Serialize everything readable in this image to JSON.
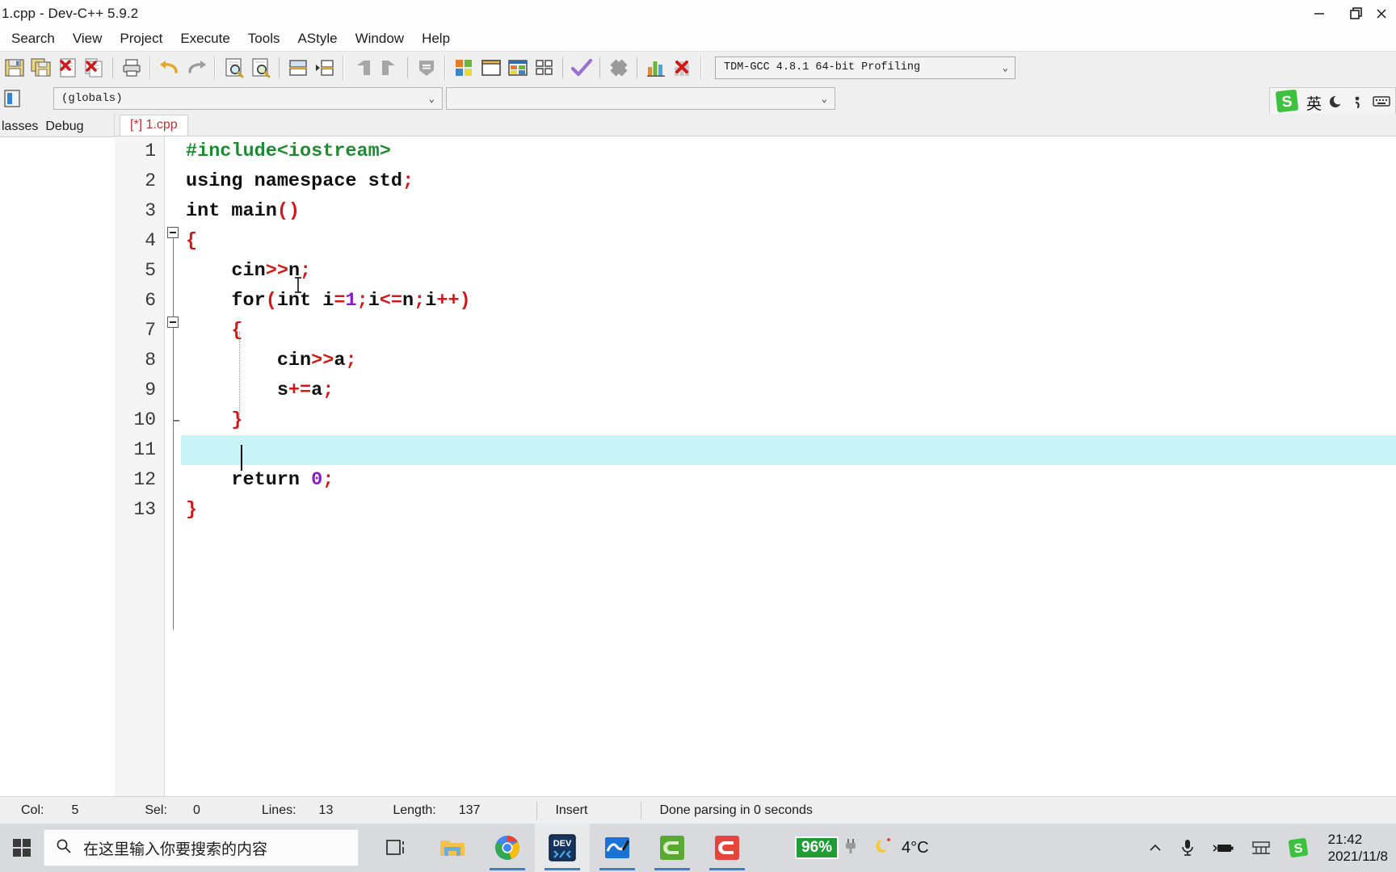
{
  "window": {
    "title": "1.cpp - Dev-C++ 5.9.2",
    "minimize_label": "minimize",
    "restore_label": "restore",
    "close_label": "close"
  },
  "menu": {
    "items": [
      {
        "label": "Search"
      },
      {
        "label": "View"
      },
      {
        "label": "Project"
      },
      {
        "label": "Execute"
      },
      {
        "label": "Tools"
      },
      {
        "label": "AStyle"
      },
      {
        "label": "Window"
      },
      {
        "label": "Help"
      }
    ]
  },
  "toolbar": {
    "icons": [
      {
        "name": "save-icon"
      },
      {
        "name": "save-all-icon"
      },
      {
        "name": "close-file-icon"
      },
      {
        "name": "close-all-icon"
      },
      {
        "name": "print-icon"
      },
      {
        "name": "undo-icon"
      },
      {
        "name": "redo-icon"
      },
      {
        "name": "find-icon"
      },
      {
        "name": "replace-icon"
      },
      {
        "name": "goto-line-icon"
      },
      {
        "name": "goto-function-icon"
      },
      {
        "name": "back-icon"
      },
      {
        "name": "forward-icon"
      },
      {
        "name": "toggle-breakpoint-icon"
      },
      {
        "name": "new-project-icon"
      },
      {
        "name": "new-file-icon"
      },
      {
        "name": "project-options-icon"
      },
      {
        "name": "window-list-icon"
      },
      {
        "name": "compile-run-icon"
      },
      {
        "name": "stop-icon"
      },
      {
        "name": "profile-icon"
      },
      {
        "name": "delete-profile-icon"
      }
    ],
    "compiler_set": "TDM-GCC 4.8.1 64-bit Profiling",
    "compiler_arrow": "⌄"
  },
  "navbar": {
    "class_browser_icon": "class-browser-icon",
    "scope_value": "(globals)",
    "member_value": "",
    "arrow": "⌄"
  },
  "left_panel": {
    "tabs": [
      {
        "label": "lasses"
      },
      {
        "label": "Debug"
      }
    ]
  },
  "editor": {
    "tab_label": "[*] 1.cpp",
    "lines": [
      {
        "num": "1",
        "tokens": [
          {
            "t": "#include<iostream>",
            "c": "t-pre"
          }
        ]
      },
      {
        "num": "2",
        "tokens": [
          {
            "t": "using namespace std",
            "c": "t-kw"
          },
          {
            "t": ";",
            "c": "t-sym"
          }
        ]
      },
      {
        "num": "3",
        "tokens": [
          {
            "t": "int main",
            "c": "t-kw"
          },
          {
            "t": "()",
            "c": "t-sym"
          }
        ]
      },
      {
        "num": "4",
        "tokens": [
          {
            "t": "{",
            "c": "t-sym"
          }
        ]
      },
      {
        "num": "5",
        "tokens": [
          {
            "t": "    cin",
            "c": "t-id"
          },
          {
            "t": ">>",
            "c": "t-sym"
          },
          {
            "t": "n",
            "c": "t-id"
          },
          {
            "t": ";",
            "c": "t-sym"
          }
        ]
      },
      {
        "num": "6",
        "tokens": [
          {
            "t": "    for",
            "c": "t-kw"
          },
          {
            "t": "(",
            "c": "t-sym"
          },
          {
            "t": "int",
            "c": "t-kw"
          },
          {
            "t": " i",
            "c": "t-id"
          },
          {
            "t": "=",
            "c": "t-sym"
          },
          {
            "t": "1",
            "c": "t-num"
          },
          {
            "t": ";",
            "c": "t-sym"
          },
          {
            "t": "i",
            "c": "t-id"
          },
          {
            "t": "<=",
            "c": "t-sym"
          },
          {
            "t": "n",
            "c": "t-id"
          },
          {
            "t": ";",
            "c": "t-sym"
          },
          {
            "t": "i",
            "c": "t-id"
          },
          {
            "t": "++)",
            "c": "t-sym"
          }
        ]
      },
      {
        "num": "7",
        "tokens": [
          {
            "t": "    {",
            "c": "t-sym"
          }
        ]
      },
      {
        "num": "8",
        "tokens": [
          {
            "t": "        cin",
            "c": "t-id"
          },
          {
            "t": ">>",
            "c": "t-sym"
          },
          {
            "t": "a",
            "c": "t-id"
          },
          {
            "t": ";",
            "c": "t-sym"
          }
        ]
      },
      {
        "num": "9",
        "tokens": [
          {
            "t": "        s",
            "c": "t-id"
          },
          {
            "t": "+=",
            "c": "t-sym"
          },
          {
            "t": "a",
            "c": "t-id"
          },
          {
            "t": ";",
            "c": "t-sym"
          }
        ]
      },
      {
        "num": "10",
        "tokens": [
          {
            "t": "    }",
            "c": "t-sym"
          }
        ]
      },
      {
        "num": "11",
        "tokens": [
          {
            "t": "    ",
            "c": "t-id"
          }
        ],
        "active": true
      },
      {
        "num": "12",
        "tokens": [
          {
            "t": "    return",
            "c": "t-kw"
          },
          {
            "t": " ",
            "c": "t-id"
          },
          {
            "t": "0",
            "c": "t-num"
          },
          {
            "t": ";",
            "c": "t-sym"
          }
        ]
      },
      {
        "num": "13",
        "tokens": [
          {
            "t": "}",
            "c": "t-sym"
          }
        ]
      }
    ]
  },
  "statusbar": {
    "col_label": "Col:",
    "col_value": "5",
    "sel_label": "Sel:",
    "sel_value": "0",
    "lines_label": "Lines:",
    "lines_value": "13",
    "length_label": "Length:",
    "length_value": "137",
    "mode": "Insert",
    "message": "Done parsing in 0 seconds"
  },
  "ime": {
    "logo": "sogou-logo-icon",
    "mode": "英",
    "moon_icon": "moon-icon",
    "comma_icon": "comma-icon",
    "keyboard_icon": "keyboard-icon"
  },
  "taskbar": {
    "start_icon": "start-icon",
    "search_icon": "search-icon",
    "search_placeholder": "在这里输入你要搜索的内容",
    "apps": [
      {
        "name": "task-view-icon",
        "active": false,
        "running": false
      },
      {
        "name": "file-explorer-icon",
        "active": false,
        "running": false
      },
      {
        "name": "chrome-icon",
        "active": false,
        "running": true
      },
      {
        "name": "devcpp-icon",
        "active": true,
        "running": true
      },
      {
        "name": "onenote-icon",
        "active": false,
        "running": true
      },
      {
        "name": "camtasia-green-icon",
        "active": false,
        "running": true
      },
      {
        "name": "camtasia-red-icon",
        "active": false,
        "running": true
      }
    ],
    "battery_percent": "96%",
    "plug_icon": "plug-icon",
    "weather_icon": "moon-weather-icon",
    "temperature": "4°C",
    "chevron_icon": "chevron-up-icon",
    "mic_icon": "microphone-icon",
    "battery_tray_icon": "battery-charging-icon",
    "network_icon": "network-icon",
    "sogou_tray_icon": "sogou-tray-icon",
    "time": "21:42",
    "date": "2021/11/8"
  },
  "colors": {
    "accent": "#3a7fd5",
    "active_line": "#c9f4f7",
    "symbol_red": "#d01818",
    "include_green": "#1f8a32",
    "number_purple": "#8b19c8",
    "battery_green": "#1f9d34"
  }
}
